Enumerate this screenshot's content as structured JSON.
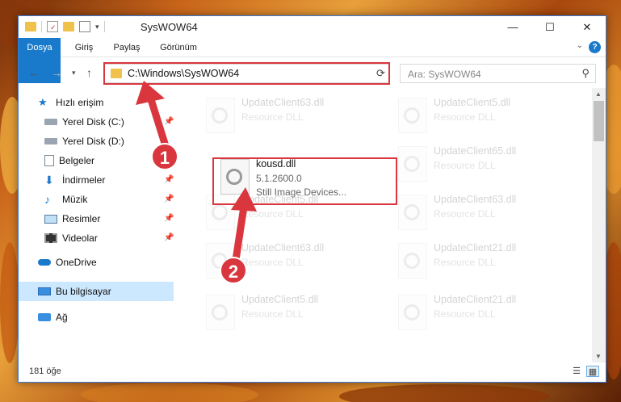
{
  "window": {
    "title": "SysWOW64"
  },
  "title_controls": {
    "minimize": "—",
    "maximize": "☐",
    "close": "✕"
  },
  "ribbon": {
    "tabs": [
      "Dosya",
      "Giriş",
      "Paylaş",
      "Görünüm"
    ],
    "help": "?"
  },
  "navigation": {
    "address": "C:\\Windows\\SysWOW64",
    "search_placeholder": "Ara: SysWOW64"
  },
  "sidebar": {
    "items": [
      {
        "label": "Hızlı erişim",
        "icon": "star-icon"
      },
      {
        "label": "Yerel Disk (C:)",
        "icon": "drive-icon",
        "pinned": true
      },
      {
        "label": "Yerel Disk (D:)",
        "icon": "drive-icon"
      },
      {
        "label": "Belgeler",
        "icon": "document-icon",
        "pinned": true
      },
      {
        "label": "İndirmeler",
        "icon": "download-icon",
        "pinned": true
      },
      {
        "label": "Müzik",
        "icon": "music-icon",
        "pinned": true
      },
      {
        "label": "Resimler",
        "icon": "picture-icon",
        "pinned": true
      },
      {
        "label": "Videolar",
        "icon": "video-icon",
        "pinned": true
      },
      {
        "label": "OneDrive",
        "icon": "cloud-icon"
      },
      {
        "label": "Bu bilgisayar",
        "icon": "computer-icon",
        "selected": true
      },
      {
        "label": "Ağ",
        "icon": "network-icon"
      }
    ]
  },
  "files": [
    {
      "name": "UpdateClient63.dll",
      "line2": "Resource DLL",
      "line3": ""
    },
    {
      "name": "UpdateClient5.dll",
      "line2": "Resource DLL",
      "line3": ""
    },
    {
      "name": "kousd.dll",
      "line2": "5.1.2600.0",
      "line3": "Still Image Devices..."
    },
    {
      "name": "UpdateClient65.dll",
      "line2": "Resource DLL",
      "line3": ""
    },
    {
      "name": "UpdateClient5.dll",
      "line2": "Resource DLL",
      "line3": ""
    },
    {
      "name": "UpdateClient63.dll",
      "line2": "Resource DLL",
      "line3": ""
    },
    {
      "name": "UpdateClient63.dll",
      "line2": "Resource DLL",
      "line3": ""
    },
    {
      "name": "UpdateClient21.dll",
      "line2": "Resource DLL",
      "line3": ""
    },
    {
      "name": "UpdateClient5.dll",
      "line2": "Resource DLL",
      "line3": ""
    },
    {
      "name": "UpdateClient21.dll",
      "line2": "Resource DLL",
      "line3": ""
    }
  ],
  "status": {
    "count": "181 öğe"
  },
  "annotations": [
    {
      "number": "1"
    },
    {
      "number": "2"
    }
  ],
  "colors": {
    "accent": "#1979ca",
    "highlight": "#d9363e",
    "selection": "#cce8ff"
  }
}
